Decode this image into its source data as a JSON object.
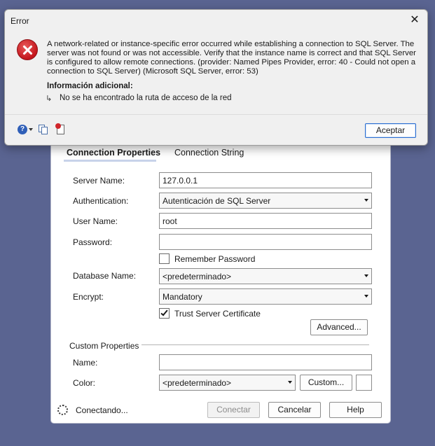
{
  "error_dialog": {
    "title": "Error",
    "message": "A network-related or instance-specific error occurred while establishing a connection to SQL Server. The server was not found or was not accessible. Verify that the instance name is correct and that SQL Server is configured to allow remote connections. (provider: Named Pipes Provider, error: 40 - Could not open a connection to SQL Server) (Microsoft SQL Server, error: 53)",
    "additional_info_title": "Información adicional:",
    "additional_info_arrow": "↳",
    "additional_info_text": "No se ha encontrado la ruta de acceso de la red",
    "ok_label": "Aceptar",
    "help_glyph": "?",
    "close_glyph": "✕",
    "icons": [
      "error-icon",
      "help-icon",
      "copy-icon",
      "details-icon"
    ],
    "colors": {
      "error_red": "#c4161c",
      "accent": "#2d6fd1"
    }
  },
  "connection_dialog": {
    "tabs": [
      {
        "label": "Connection Properties",
        "active": true
      },
      {
        "label": "Connection String",
        "active": false
      }
    ],
    "server_name": {
      "label": "Server Name:",
      "value": "127.0.0.1"
    },
    "authentication": {
      "label": "Authentication:",
      "value": "Autenticación de SQL Server"
    },
    "user_name": {
      "label": "User Name:",
      "value": "root"
    },
    "password": {
      "label": "Password:",
      "value": ""
    },
    "remember_password": {
      "label": "Remember Password",
      "checked": false
    },
    "database_name": {
      "label": "Database Name:",
      "value": "<predeterminado>"
    },
    "encrypt": {
      "label": "Encrypt:",
      "value": "Mandatory"
    },
    "trust_server_certificate": {
      "label": "Trust Server Certificate",
      "checked": true
    },
    "advanced_label": "Advanced...",
    "custom_properties": {
      "title": "Custom Properties",
      "name": {
        "label": "Name:",
        "value": ""
      },
      "color": {
        "label": "Color:",
        "value": "<predeterminado>",
        "custom_label": "Custom..."
      }
    },
    "status": "Conectando...",
    "buttons": {
      "connect": "Conectar",
      "cancel": "Cancelar",
      "help": "Help"
    }
  }
}
